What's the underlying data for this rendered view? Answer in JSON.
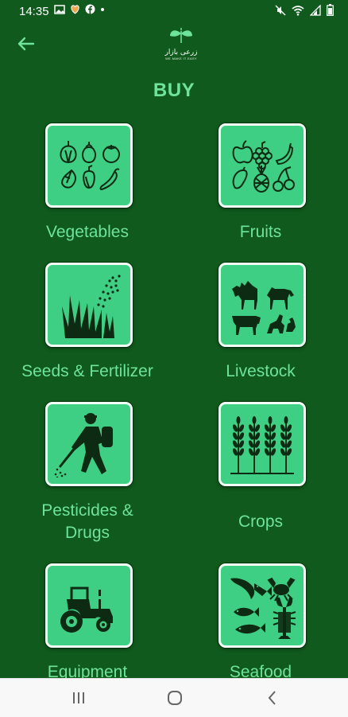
{
  "status_bar": {
    "time": "14:35",
    "left_icons": [
      "gallery-icon",
      "heart-shield-icon",
      "facebook-icon",
      "dot-icon"
    ],
    "right_icons": [
      "mute-icon",
      "wifi-icon",
      "signal-icon",
      "battery-icon"
    ]
  },
  "header": {
    "logo_text": "زرعی بازار",
    "logo_tagline": "WE MAKE IT EASY",
    "back_icon": "arrow-left-icon"
  },
  "page_title": "BUY",
  "categories": [
    {
      "label": "Vegetables",
      "icon": "vegetables-icon"
    },
    {
      "label": "Fruits",
      "icon": "fruits-icon"
    },
    {
      "label": "Seeds & Fertilizer",
      "icon": "seeds-icon"
    },
    {
      "label": "Livestock",
      "icon": "livestock-icon"
    },
    {
      "label": "Pesticides &\nDrugs",
      "icon": "pesticide-sprayer-icon"
    },
    {
      "label": "Crops",
      "icon": "crops-icon"
    },
    {
      "label": "Equipment",
      "icon": "tractor-icon"
    },
    {
      "label": "Seafood",
      "icon": "seafood-icon"
    }
  ],
  "nav": [
    "recent-apps-icon",
    "home-icon",
    "back-icon"
  ],
  "colors": {
    "background": "#0f5a1c",
    "tile": "#3fcf84",
    "accent": "#6ee39a"
  }
}
